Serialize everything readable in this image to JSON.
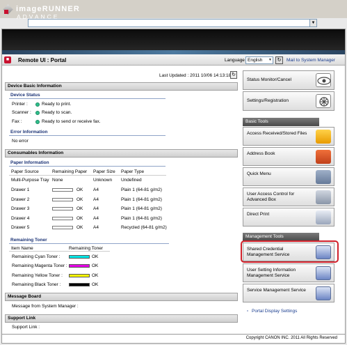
{
  "brand": {
    "line1": "imageRUNNER",
    "line2": "ADVANCE"
  },
  "header": {
    "title": "Remote UI : Portal",
    "language_label": "Language",
    "language_value": "English",
    "mail_link": "Mail to System Manager"
  },
  "last_updated": "Last Updated : 2011 10/06 14:13:18",
  "device_basic": {
    "heading": "Device Basic Information",
    "status_heading": "Device Status",
    "status": [
      {
        "label": "Printer :",
        "value": "Ready to print."
      },
      {
        "label": "Scanner :",
        "value": "Ready to scan."
      },
      {
        "label": "Fax :",
        "value": "Ready to send or receive fax."
      }
    ],
    "error_heading": "Error Information",
    "error_text": "No error"
  },
  "consumables": {
    "heading": "Consumables Information",
    "paper_heading": "Paper Information",
    "paper_columns": [
      "Paper Source",
      "Remaining Paper",
      "Paper Size",
      "Paper Type"
    ],
    "paper_rows": [
      {
        "source": "Multi-Purpose Tray",
        "remaining": "None",
        "size": "Unknown",
        "type": "Undefined",
        "bar": false
      },
      {
        "source": "Drawer 1",
        "remaining": "OK",
        "size": "A4",
        "type": "Plain 1 (64-81 g/m2)",
        "bar": true
      },
      {
        "source": "Drawer 2",
        "remaining": "OK",
        "size": "A4",
        "type": "Plain 1 (64-81 g/m2)",
        "bar": true
      },
      {
        "source": "Drawer 3",
        "remaining": "OK",
        "size": "A4",
        "type": "Plain 1 (64-81 g/m2)",
        "bar": true
      },
      {
        "source": "Drawer 4",
        "remaining": "OK",
        "size": "A4",
        "type": "Plain 1 (64-81 g/m2)",
        "bar": true
      },
      {
        "source": "Drawer 5",
        "remaining": "OK",
        "size": "A4",
        "type": "Recycled (64-81 g/m2)",
        "bar": true
      }
    ],
    "toner_heading": "Remaining Toner",
    "toner_columns": [
      "Item Name",
      "Remaining Toner"
    ],
    "toner_rows": [
      {
        "name": "Remaining Cyan Toner :",
        "status": "OK",
        "color": "#00e5e5"
      },
      {
        "name": "Remaining Magenta Toner :",
        "status": "OK",
        "color": "#e600e6"
      },
      {
        "name": "Remaining Yellow Toner :",
        "status": "OK",
        "color": "#ffff00"
      },
      {
        "name": "Remaining Black Toner :",
        "status": "OK",
        "color": "#000000"
      }
    ]
  },
  "message_board": {
    "heading": "Message Board",
    "text": "Message from System Manager :"
  },
  "support_link": {
    "heading": "Support Link",
    "text": "Support Link :"
  },
  "right_panel": {
    "status_monitor": "Status Monitor/Cancel",
    "settings": "Settings/Registration",
    "basic_tools_heading": "Basic Tools",
    "basic_tools": [
      {
        "label": "Access Received/Stored Files",
        "icon": "folder-icon"
      },
      {
        "label": "Address Book",
        "icon": "address-book-icon"
      },
      {
        "label": "Quick Menu",
        "icon": "quick-menu-icon"
      },
      {
        "label": "User Access Control for Advanced Box",
        "icon": "access-control-icon"
      },
      {
        "label": "Direct Print",
        "icon": "printer-icon"
      }
    ],
    "management_heading": "Management Tools",
    "management_tools": [
      {
        "label": "Shared Credential Management Service",
        "icon": "monitor-icon"
      },
      {
        "label": "User Setting Information Management Service",
        "icon": "monitor-icon"
      },
      {
        "label": "Service Management Service",
        "icon": "monitor-icon"
      }
    ],
    "portal_settings": "Portal Display Settings"
  },
  "copyright": "Copyright CANON INC. 2011 All Rights Reserved"
}
